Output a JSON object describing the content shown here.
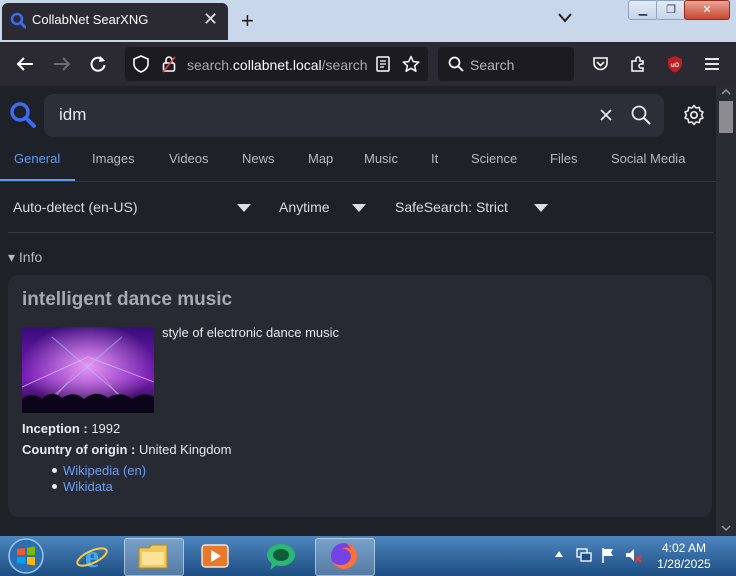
{
  "browser": {
    "tab_title": "CollabNet SearXNG",
    "url_domain_prefix": "search.",
    "url_domain_main": "collabnet.local",
    "url_path": "/search",
    "search_placeholder": "Search",
    "newtab_glyph": "+",
    "close_glyph": "✕"
  },
  "search": {
    "query": "idm"
  },
  "categories": [
    {
      "label": "General",
      "active": true
    },
    {
      "label": "Images"
    },
    {
      "label": "Videos"
    },
    {
      "label": "News"
    },
    {
      "label": "Map"
    },
    {
      "label": "Music"
    },
    {
      "label": "It"
    },
    {
      "label": "Science"
    },
    {
      "label": "Files"
    },
    {
      "label": "Social Media"
    }
  ],
  "filters": {
    "language": "Auto-detect (en-US)",
    "time": "Anytime",
    "safesearch": "SafeSearch: Strict"
  },
  "infobox": {
    "section_label": "▾ Info",
    "title": "intelligent dance music",
    "description": "style of electronic dance music",
    "attributes": [
      {
        "label": "Inception :",
        "value": " 1992"
      },
      {
        "label": "Country of origin :",
        "value": " United Kingdom"
      }
    ],
    "links": [
      "Wikipedia (en)",
      "Wikidata"
    ]
  },
  "taskbar": {
    "time": "4:02 AM",
    "date": "1/28/2025"
  },
  "colors": {
    "accent": "#5b9cf0",
    "page_bg": "#1f2128",
    "link": "#6b9cf5"
  }
}
